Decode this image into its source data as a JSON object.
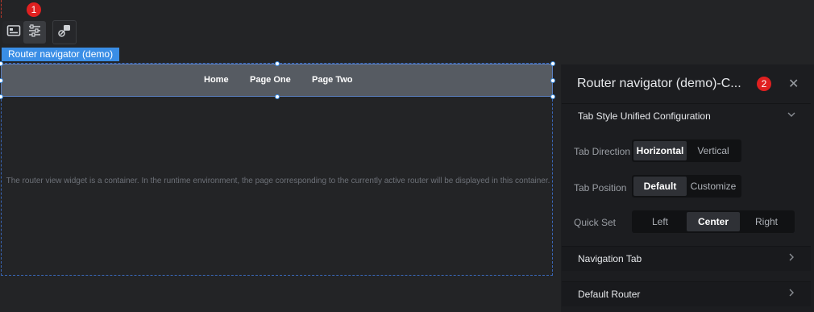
{
  "toolbar": {
    "badge": "1",
    "buttons": [
      {
        "icon": "image-icon"
      },
      {
        "icon": "sliders-icon"
      },
      {
        "icon": "shapes-icon"
      }
    ]
  },
  "widget": {
    "label": "Router navigator (demo)",
    "tabs": [
      "Home",
      "Page One",
      "Page Two"
    ],
    "container_text": "The router view widget is a container. In the runtime environment, the page corresponding to the currently active router will be displayed in this container."
  },
  "panel": {
    "title": "Router navigator (demo)-C...",
    "badge": "2",
    "sections": {
      "tab_style": "Tab Style Unified Configuration",
      "navigation_tab": "Navigation Tab",
      "default_router": "Default Router"
    },
    "tab_direction": {
      "label": "Tab Direction",
      "options": [
        "Horizontal",
        "Vertical"
      ],
      "selected": "Horizontal"
    },
    "tab_position": {
      "label": "Tab Position",
      "options": [
        "Default",
        "Customize"
      ],
      "selected": "Default"
    },
    "quick_set": {
      "label": "Quick Set",
      "options": [
        "Left",
        "Center",
        "Right"
      ],
      "selected": "Center"
    }
  },
  "colors": {
    "accent": "#3a8ee6",
    "badge": "#e02020",
    "background": "#232426",
    "panel": "#1c1d20"
  }
}
